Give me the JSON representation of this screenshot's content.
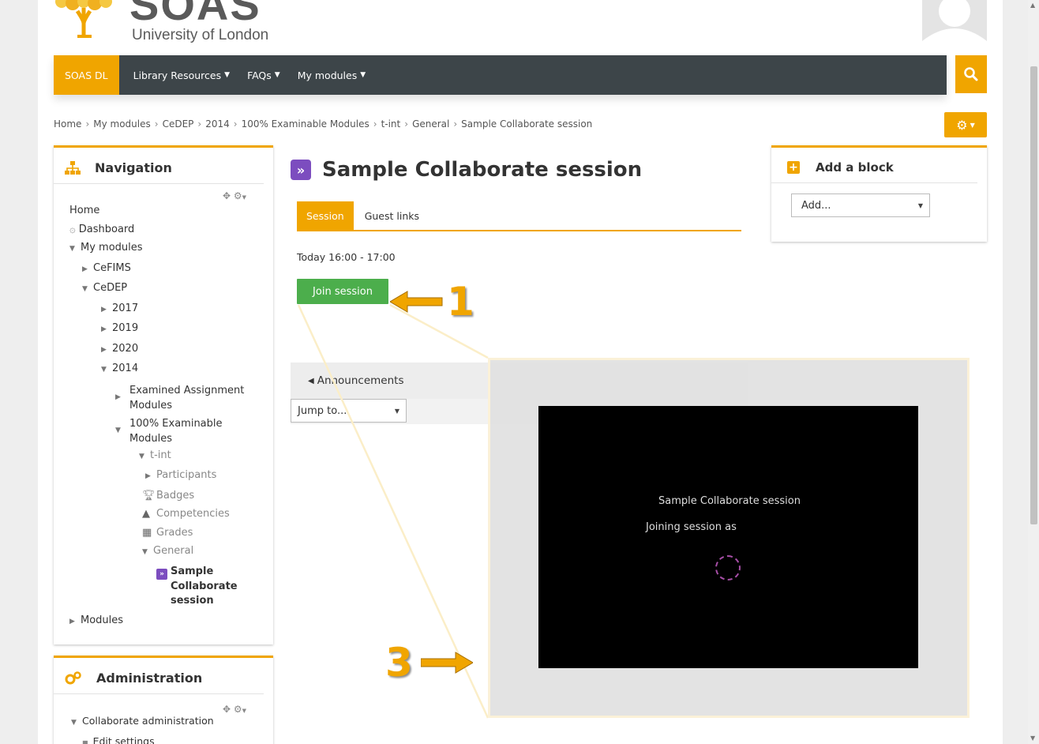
{
  "header": {
    "logo_text": "SOAS",
    "logo_subtitle": "University of London"
  },
  "navbar": {
    "brand": "SOAS DL",
    "items": [
      {
        "label": "Library Resources"
      },
      {
        "label": "FAQs"
      },
      {
        "label": "My modules"
      }
    ]
  },
  "breadcrumb": [
    "Home",
    "My modules",
    "CeDEP",
    "2014",
    "100% Examinable Modules",
    "t-int",
    "General",
    "Sample Collaborate session"
  ],
  "navigation_block": {
    "title": "Navigation",
    "home": "Home",
    "dashboard": "Dashboard",
    "my_modules": "My modules",
    "cefims": "CeFIMS",
    "cedep": "CeDEP",
    "y2017": "2017",
    "y2019": "2019",
    "y2020": "2020",
    "y2014": "2014",
    "examined_1": "Examined Assignment",
    "examined_2": "Modules",
    "examinable_1": "100% Examinable",
    "examinable_2": "Modules",
    "tint": "t-int",
    "participants": "Participants",
    "badges": "Badges",
    "competencies": "Competencies",
    "grades": "Grades",
    "general": "General",
    "current_1": "Sample",
    "current_2": "Collaborate",
    "current_3": "session",
    "modules": "Modules"
  },
  "admin_block": {
    "title": "Administration",
    "collab_admin": "Collaborate administration",
    "edit_settings": "Edit settings"
  },
  "main": {
    "title": "Sample Collaborate session",
    "tabs": [
      {
        "label": "Session",
        "active": true
      },
      {
        "label": "Guest links",
        "active": false
      }
    ],
    "time": "Today 16:00 - 17:00",
    "join_button": "Join session",
    "announcements": "Announcements",
    "jump_to": "Jump to..."
  },
  "add_block": {
    "title": "Add a block",
    "select_value": "Add..."
  },
  "video_panel": {
    "title": "Sample Collaborate session",
    "subtitle": "Joining session as"
  },
  "annotations": {
    "one": "1",
    "three": "3"
  },
  "colors": {
    "accent": "#f0a500",
    "navbar": "#3d4549",
    "join_button": "#4cae4c",
    "collaborate_icon": "#7c4dbf"
  }
}
